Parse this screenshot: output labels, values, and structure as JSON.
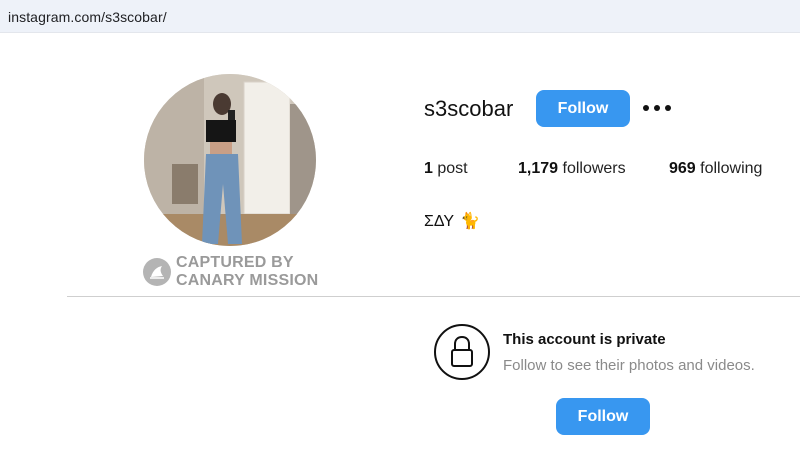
{
  "browser": {
    "url": "instagram.com/s3scobar/"
  },
  "watermark": {
    "line1": "CAPTURED BY",
    "line2": "CANARY MISSION",
    "icon": "canary-bird-icon"
  },
  "profile": {
    "username": "s3scobar",
    "follow_label": "Follow",
    "more_icon": "more-options-icon",
    "stats": {
      "posts_count": "1",
      "posts_label": "post",
      "followers_count": "1,179",
      "followers_label": "followers",
      "following_count": "969",
      "following_label": "following"
    },
    "bio": "ΣΔΥ",
    "bio_emoji": "🐈"
  },
  "private_notice": {
    "icon": "lock-icon",
    "title": "This account is private",
    "subtitle": "Follow to see their photos and videos.",
    "follow_label": "Follow"
  },
  "colors": {
    "accent": "#3897f0",
    "watermark": "#9a9a9a"
  }
}
